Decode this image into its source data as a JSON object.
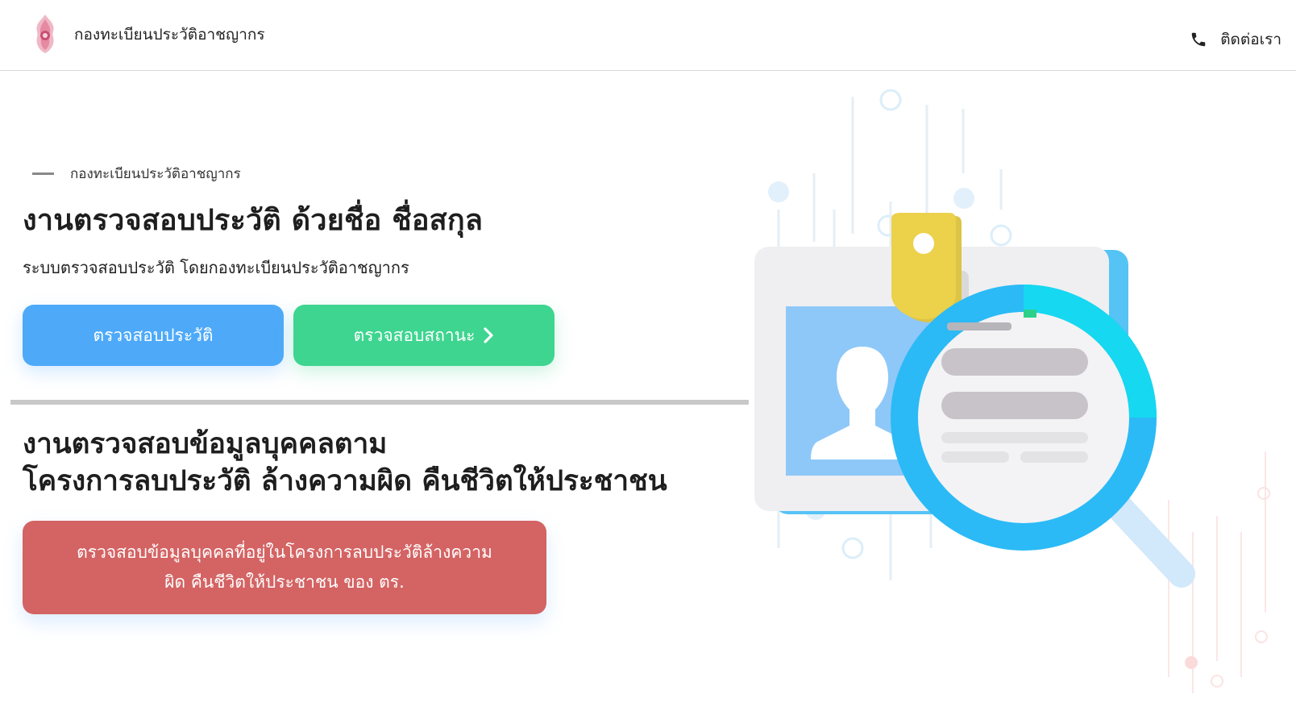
{
  "header": {
    "site_title": "กองทะเบียนประวัติอาชญากร",
    "contact_label": "ติดต่อเรา",
    "contact_icon": "phone-icon",
    "logo_icon": "emblem-logo"
  },
  "hero": {
    "eyebrow": "กองทะเบียนประวัติอาชญากร",
    "title": "งานตรวจสอบประวัติ ด้วยชื่อ ชื่อสกุล",
    "subtitle": "ระบบตรวจสอบประวัติ โดยกองทะเบียนประวัติอาชญากร",
    "check_button": "ตรวจสอบประวัติ",
    "status_button": "ตรวจสอบสถานะ",
    "status_button_icon": "chevron-right-icon"
  },
  "section": {
    "title_line1": "งานตรวจสอบข้อมูลบุคคลตาม",
    "title_line2": "โครงการลบประวัติ ล้างความผิด คืนชีวิตให้ประชาชน",
    "red_button_line1": "ตรวจสอบข้อมูลบุคคลที่อยู่ในโครงการลบประวัติล้างความ",
    "red_button_line2": "ผิด คืนชีวิตให้ประชาชน ของ ตร."
  },
  "colors": {
    "blue_button": "#4eaaf9",
    "green_button": "#3ed590",
    "red_button": "#d46363",
    "magnifier": "#29c0f5"
  },
  "illustration_icon": "id-card-magnifier-illustration"
}
